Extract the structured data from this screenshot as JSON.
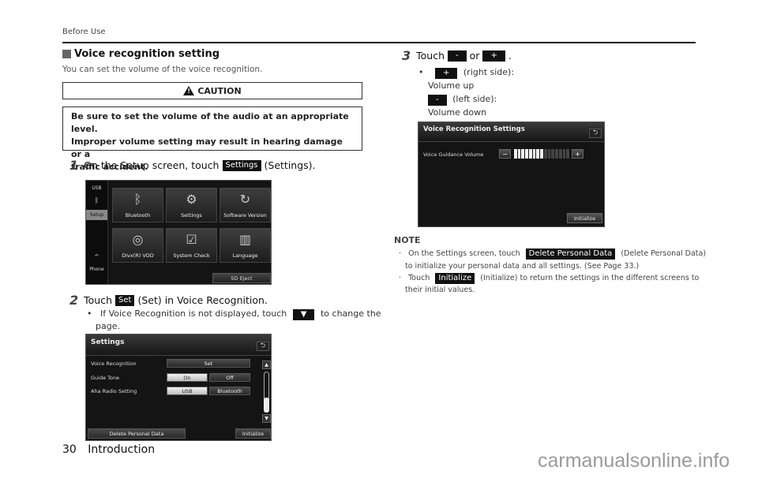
{
  "header": {
    "section": "Before Use"
  },
  "section": {
    "title": "Voice recognition setting",
    "intro": "You can set the volume of the voice recognition."
  },
  "caution": {
    "heading": "CAUTION",
    "icon": "warning-triangle-icon",
    "body_lines": [
      "Be sure to set the volume of the audio at an appropriate level.",
      "Improper volume setting may result in hearing damage or a",
      "traffic accident."
    ]
  },
  "step1": {
    "num": "1",
    "before": "On the Setup screen, touch",
    "button": "Settings",
    "after": "(Settings).",
    "screen": {
      "sidebar": [
        "USB",
        "Bluetooth",
        "Setup",
        "^",
        "Phone"
      ],
      "tiles": [
        {
          "label": "Bluetooth",
          "icon": "bluetooth-icon"
        },
        {
          "label": "Settings",
          "icon": "tools-icon"
        },
        {
          "label": "Software Version",
          "icon": "refresh-icon"
        },
        {
          "label": "Divx(R) VOD",
          "icon": "disc-icon"
        },
        {
          "label": "System Check",
          "icon": "checklist-icon"
        },
        {
          "label": "Language",
          "icon": "book-icon"
        }
      ],
      "sd_eject": "SD Eject"
    }
  },
  "step2": {
    "num": "2",
    "before": "Touch",
    "button": "Set",
    "after": "(Set) in Voice Recognition.",
    "bullet_before": "If Voice Recognition is not displayed, touch",
    "bullet_button": "▼",
    "bullet_after": "to change the",
    "bullet_cont": "page.",
    "screen": {
      "title": "Settings",
      "rows": [
        {
          "label": "Voice Recognition",
          "options": [
            "Set"
          ],
          "selected": null
        },
        {
          "label": "Guide Tone",
          "options": [
            "On",
            "Off"
          ],
          "selected": "On"
        },
        {
          "label": "Aha Radio Setting",
          "options": [
            "USB",
            "Bluetooth"
          ],
          "selected": "USB"
        }
      ],
      "delete_button": "Delete Personal Data",
      "initialize_button": "Initialize"
    }
  },
  "step3": {
    "num": "3",
    "before": "Touch",
    "minus": "-",
    "or": "or",
    "plus": "+",
    "after": ".",
    "plus_desc": "(right side):",
    "plus_result": "Volume up",
    "minus_desc": "(left side):",
    "minus_result": "Volume down",
    "screen": {
      "title": "Voice Recognition Settings",
      "volume_label": "Voice Guidance Volume",
      "volume_level": 8,
      "volume_max": 15,
      "minus": "−",
      "plus": "+",
      "initialize_button": "Initialize"
    }
  },
  "note": {
    "title": "NOTE",
    "item1_before": "On the Settings screen, touch",
    "item1_button": "Delete Personal Data",
    "item1_after": "(Delete Personal Data)",
    "item1_cont": "to initialize your personal data and all settings. (See Page 33.)",
    "item2_before": "Touch",
    "item2_button": "Initialize",
    "item2_after": "(Initialize) to return the settings in the different screens to",
    "item2_cont": "their initial values."
  },
  "footer": {
    "page": "30",
    "chapter": "Introduction"
  },
  "watermark": "carmanualsonline.info"
}
